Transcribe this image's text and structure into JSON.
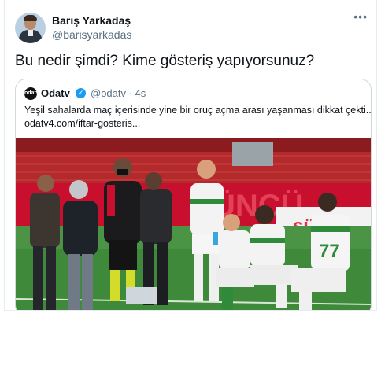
{
  "tweet": {
    "author_name": "Barış Yarkadaş",
    "author_handle": "@barisyarkadas",
    "more_icon": "more-icon",
    "text": "Bu nedir şimdi? Kime gösteriş yapıyorsunuz?"
  },
  "quote": {
    "logo_text": "odatv",
    "name": "Odatv",
    "handle_time": "@odatv · 4s",
    "text": "Yeşil sahalarda maç içerisinde yine bir oruç açma arası yaşanması dikkat çekti...",
    "url": "odatv4.com/iftar-gosteris...",
    "media": {
      "description_icon": "football-photo",
      "board_text_1": "ÜNCÜ",
      "board_text_2": "sürpri",
      "player_number": "77"
    }
  },
  "colors": {
    "verified": "#1d9bf0",
    "secondary_text": "#5b7083",
    "border": "#cfd9de"
  }
}
